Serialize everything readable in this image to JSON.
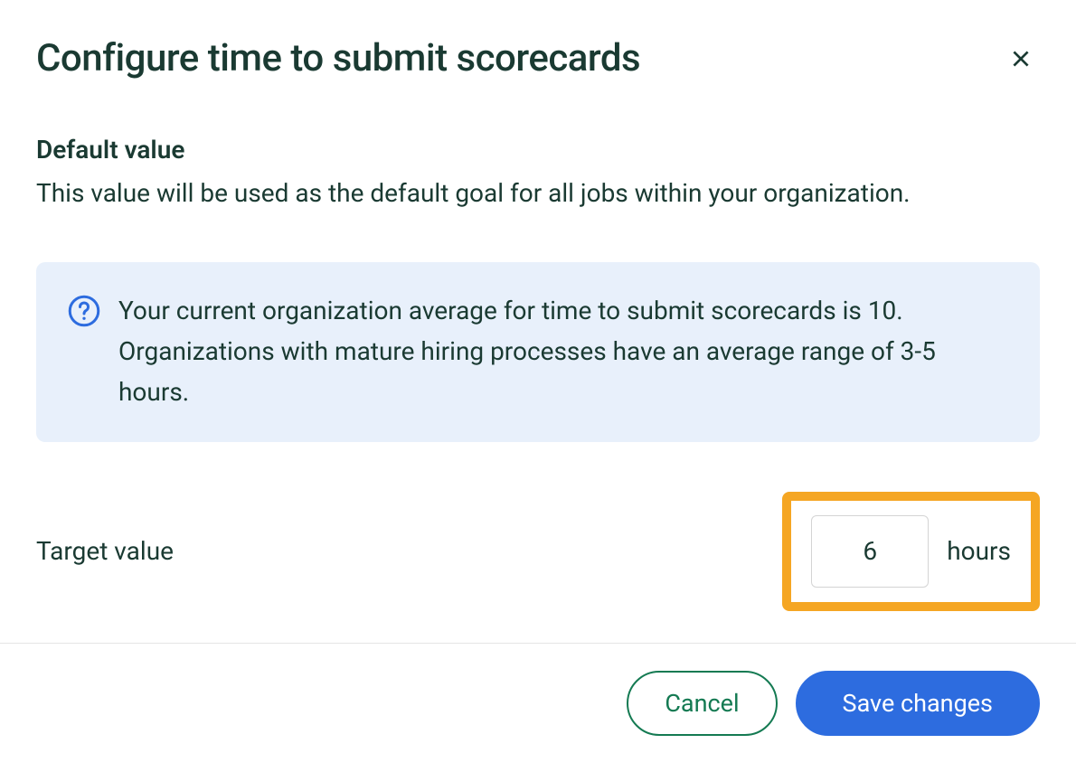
{
  "dialog": {
    "title": "Configure time to submit scorecards"
  },
  "section": {
    "heading": "Default value",
    "description": "This value will be used as the default goal for all jobs within your organization."
  },
  "banner": {
    "text": "Your current organization average for time to submit scorecards is 10. Organizations with mature hiring processes have an average range of 3-5 hours."
  },
  "target": {
    "label": "Target value",
    "value": "6",
    "unit": "hours"
  },
  "footer": {
    "cancel": "Cancel",
    "save": "Save changes"
  }
}
